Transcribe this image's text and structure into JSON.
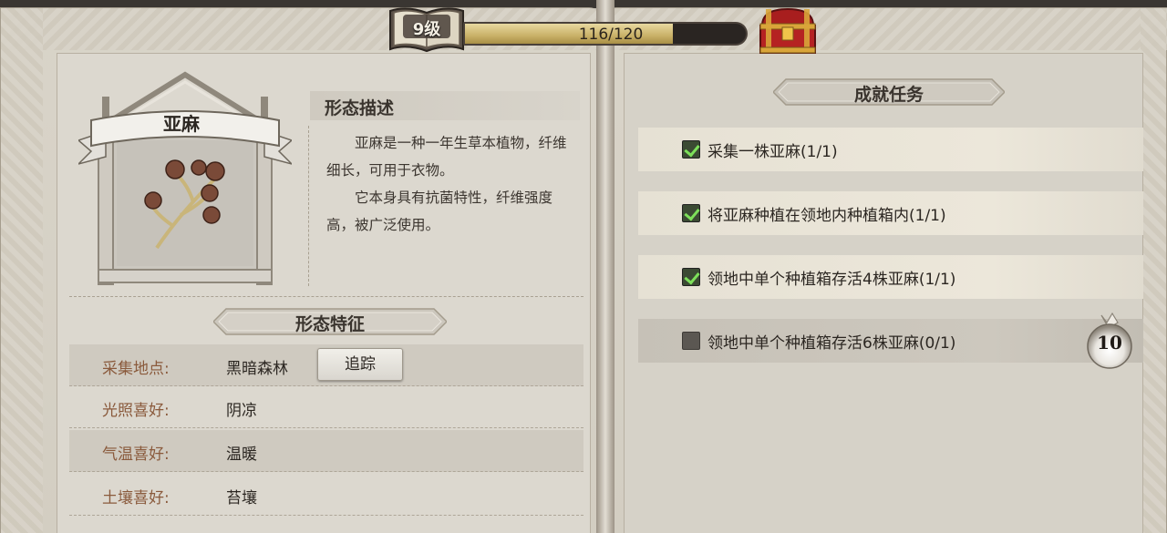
{
  "header": {
    "level_label": "9级",
    "xp_text": "116/120",
    "xp_progress": 0.9667
  },
  "plant": {
    "name": "亚麻",
    "description_title": "形态描述",
    "description_paragraphs": [
      "亚麻是一种一年生草本植物，纤维细长，可用于衣物。",
      "它本身具有抗菌特性，纤维强度高，被广泛使用。"
    ]
  },
  "features": {
    "title": "形态特征",
    "track_label": "追踪",
    "rows": [
      {
        "label": "采集地点:",
        "value": "黑暗森林"
      },
      {
        "label": "光照喜好:",
        "value": "阴凉"
      },
      {
        "label": "气温喜好:",
        "value": "温暖"
      },
      {
        "label": "土壤喜好:",
        "value": "苔壤"
      }
    ]
  },
  "achievements": {
    "title": "成就任务",
    "tasks": [
      {
        "text": "采集一株亚麻(1/1)",
        "done": true
      },
      {
        "text": "将亚麻种植在领地内种植箱内(1/1)",
        "done": true
      },
      {
        "text": "领地中单个种植箱存活4株亚麻(1/1)",
        "done": true
      },
      {
        "text": "领地中单个种植箱存活6株亚麻(0/1)",
        "done": false
      }
    ],
    "reward_amount": "10"
  },
  "colors": {
    "label_brown": "#8a5a3c",
    "check_green": "#7de05a",
    "xp_gold": "#c9b168"
  }
}
